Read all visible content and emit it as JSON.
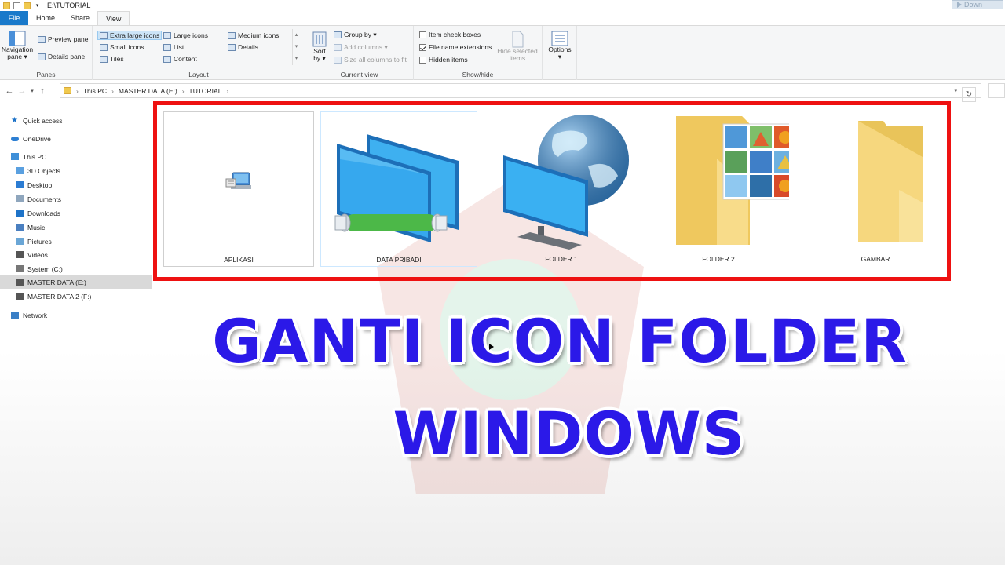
{
  "window": {
    "title": "E:\\TUTORIAL",
    "download_label": "Down"
  },
  "tabs": [
    "File",
    "Home",
    "Share",
    "View"
  ],
  "ribbon": {
    "panes": {
      "label": "Panes",
      "navigation_pane": "Navigation\npane ▾",
      "preview_pane": "Preview pane",
      "details_pane": "Details pane"
    },
    "layout": {
      "label": "Layout",
      "options": [
        "Extra large icons",
        "Large icons",
        "Medium icons",
        "Small icons",
        "List",
        "Details",
        "Tiles",
        "Content"
      ],
      "selected": "Extra large icons"
    },
    "current_view": {
      "label": "Current view",
      "sort_by": "Sort\nby ▾",
      "group_by": "Group by ▾",
      "add_columns": "Add columns ▾",
      "size_all": "Size all columns to fit"
    },
    "show_hide": {
      "label": "Show/hide",
      "item_check_boxes": "Item check boxes",
      "file_name_extensions": "File name extensions",
      "hidden_items": "Hidden items",
      "hide_selected": "Hide selected\nitems",
      "checks": {
        "item_check_boxes": false,
        "file_name_extensions": true,
        "hidden_items": false
      }
    },
    "options": {
      "label": "Options\n▾"
    }
  },
  "address": {
    "path": [
      "This PC",
      "MASTER DATA (E:)",
      "TUTORIAL"
    ]
  },
  "sidebar": {
    "items": [
      {
        "label": "Quick access",
        "icon": "star-icon",
        "color": "#1e73c8"
      },
      {
        "label": "OneDrive",
        "icon": "cloud-icon",
        "color": "#2d7fd3"
      },
      {
        "label": "This PC",
        "icon": "computer-icon",
        "color": "#3f8fd8"
      },
      {
        "label": "3D Objects",
        "icon": "cube-icon",
        "color": "#5aa0e0"
      },
      {
        "label": "Desktop",
        "icon": "desktop-icon",
        "color": "#2b7cd3"
      },
      {
        "label": "Documents",
        "icon": "documents-icon",
        "color": "#8fa6bd"
      },
      {
        "label": "Downloads",
        "icon": "download-icon",
        "color": "#1e73c8"
      },
      {
        "label": "Music",
        "icon": "music-icon",
        "color": "#4a7fc0"
      },
      {
        "label": "Pictures",
        "icon": "pictures-icon",
        "color": "#6aa6d6"
      },
      {
        "label": "Videos",
        "icon": "videos-icon",
        "color": "#555"
      },
      {
        "label": "System (C:)",
        "icon": "drive-icon",
        "color": "#777"
      },
      {
        "label": "MASTER DATA (E:)",
        "icon": "drive-icon",
        "color": "#555",
        "selected": true
      },
      {
        "label": "MASTER DATA 2 (F:)",
        "icon": "drive-icon",
        "color": "#555"
      },
      {
        "label": "Network",
        "icon": "network-icon",
        "color": "#3a7fc6"
      }
    ]
  },
  "files": [
    {
      "name": "APLIKASI",
      "icon": "application-icon"
    },
    {
      "name": "DATA PRIBADI",
      "icon": "network-monitors-icon"
    },
    {
      "name": "FOLDER 1",
      "icon": "globe-monitor-icon"
    },
    {
      "name": "FOLDER 2",
      "icon": "pictures-folder-icon"
    },
    {
      "name": "GAMBAR",
      "icon": "folder-icon"
    }
  ],
  "headline": {
    "line1": "GANTI ICON FOLDER",
    "line2": "WINDOWS",
    "color": "#2b19e8"
  }
}
